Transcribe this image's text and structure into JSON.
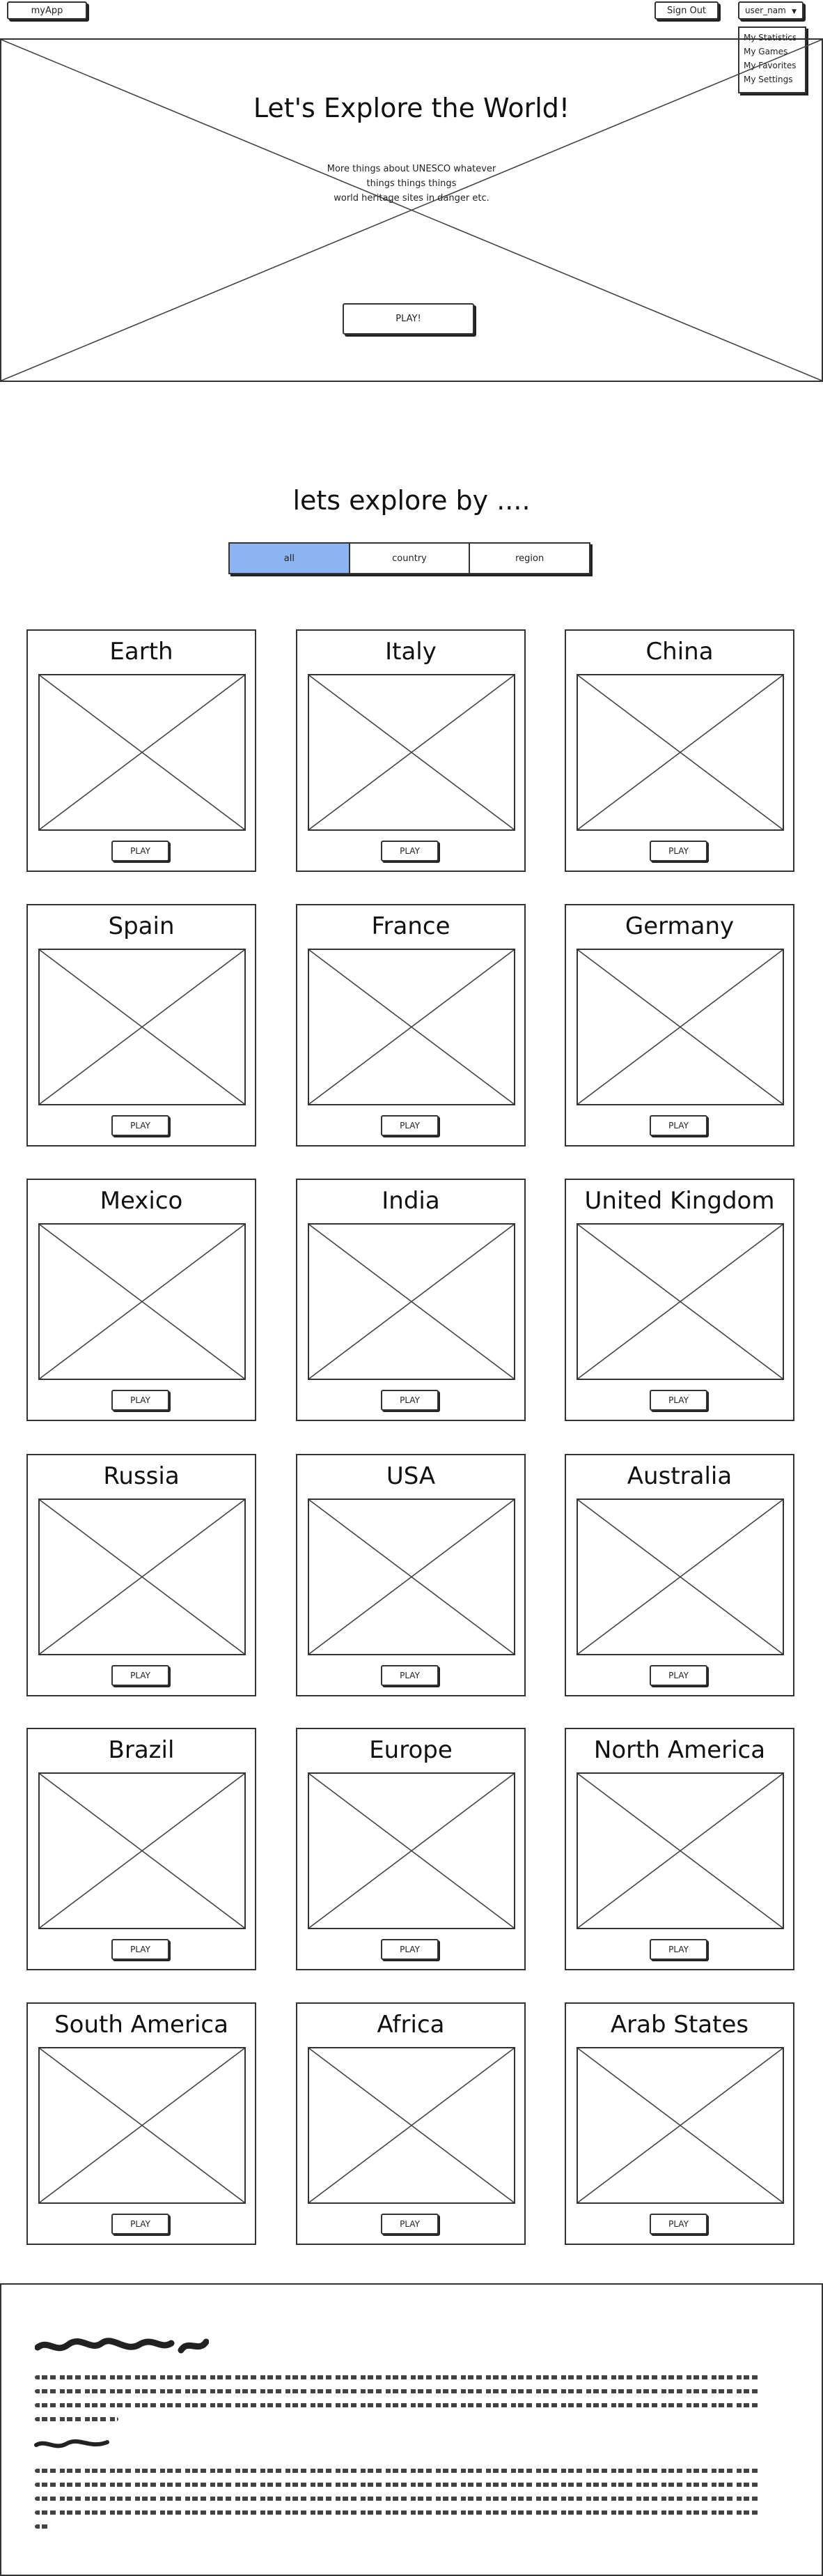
{
  "header": {
    "logo": "myApp",
    "sign_out": "Sign Out",
    "user": "user_nam"
  },
  "user_menu": [
    "My Statistics",
    "My Games",
    "My Favorites",
    "My Settings"
  ],
  "hero": {
    "title": "Let's Explore the World!",
    "description": [
      "More things about UNESCO whatever",
      "things things things",
      "world heritage sites in danger etc."
    ],
    "play": "PLAY!"
  },
  "explore": {
    "title": "lets explore by ....",
    "filters": [
      "all",
      "country",
      "region"
    ],
    "active_filter": "all",
    "active_color": "#8cb4f0"
  },
  "cards": [
    {
      "title": "Earth",
      "play": "PLAY"
    },
    {
      "title": "Italy",
      "play": "PLAY"
    },
    {
      "title": "China",
      "play": "PLAY"
    },
    {
      "title": "Spain",
      "play": "PLAY"
    },
    {
      "title": "France",
      "play": "PLAY"
    },
    {
      "title": "Germany",
      "play": "PLAY"
    },
    {
      "title": "Mexico",
      "play": "PLAY"
    },
    {
      "title": "India",
      "play": "PLAY"
    },
    {
      "title": "United Kingdom",
      "play": "PLAY"
    },
    {
      "title": "Russia",
      "play": "PLAY"
    },
    {
      "title": "USA",
      "play": "PLAY"
    },
    {
      "title": "Australia",
      "play": "PLAY"
    },
    {
      "title": "Brazil",
      "play": "PLAY"
    },
    {
      "title": "Europe",
      "play": "PLAY"
    },
    {
      "title": "North America",
      "play": "PLAY"
    },
    {
      "title": "South America",
      "play": "PLAY"
    },
    {
      "title": "Africa",
      "play": "PLAY"
    },
    {
      "title": "Arab States",
      "play": "PLAY"
    }
  ]
}
